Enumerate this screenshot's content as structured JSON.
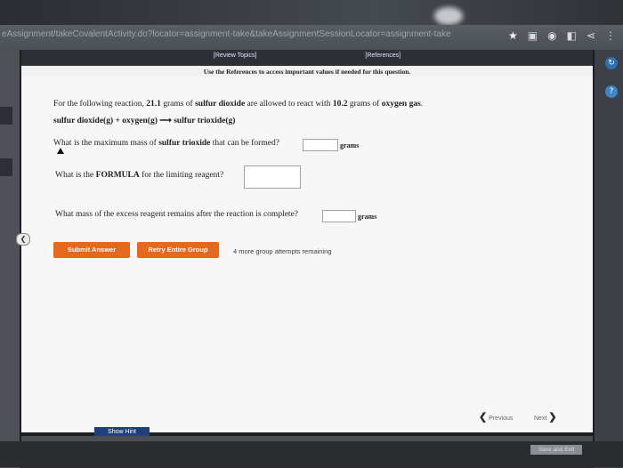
{
  "browser": {
    "url": "eAssignment/takeCovalentActivity.do?locator=assignment-take&takeAssignmentSessionLocator=assignment-take"
  },
  "header": {
    "review_topics": "[Review Topics]",
    "references": "[References]",
    "note": "Use the References to access important values if needed for this question."
  },
  "question": {
    "intro_pre": "For the following reaction,",
    "amount1": "21.1",
    "intro_mid1": "grams of",
    "reactant1": "sulfur dioxide",
    "intro_mid2": "are allowed to react with",
    "amount2": "10.2",
    "intro_mid3": "grams of",
    "reactant2": "oxygen gas",
    "intro_end": ".",
    "equation": "sulfur dioxide(g) + oxygen(g) ⟶ sulfur trioxide(g)",
    "q1_pre": "What is the maximum mass of",
    "q1_bold": "sulfur trioxide",
    "q1_post": "that can be formed?",
    "q1_unit": "grams",
    "q2_pre": "What is the",
    "q2_bold": "FORMULA",
    "q2_post": "for the limiting reagent?",
    "q3": "What mass of the excess reagent remains after the reaction is complete?",
    "q3_unit": "grams"
  },
  "actions": {
    "submit": "Submit Answer",
    "retry": "Retry Entire Group",
    "attempts": "4 more group attempts remaining",
    "previous": "Previous",
    "next": "Next",
    "show_hint": "Show Hint",
    "save_exit": "Save and Exit"
  },
  "colors": {
    "button_orange": "#e4691f",
    "hint_blue": "#1f3f7a"
  }
}
